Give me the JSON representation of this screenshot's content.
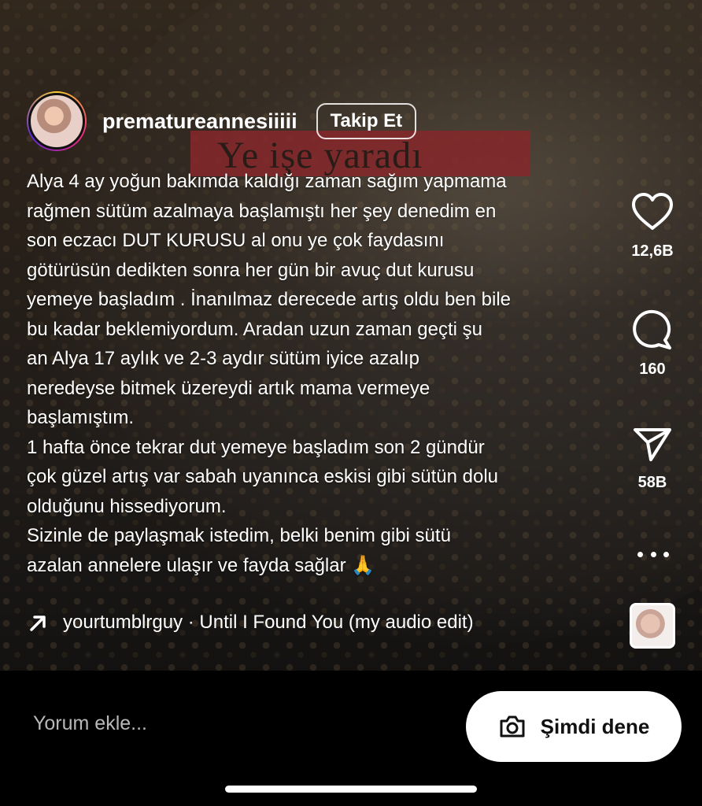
{
  "video": {
    "overlay_text": "Ye işe yaradı"
  },
  "header": {
    "username": "prematureannesiiiii",
    "follow_label": "Takip Et"
  },
  "caption": {
    "text": "Alya 4 ay yoğun bakımda kaldığı zaman sağım yapmama\nrağmen sütüm azalmaya başlamıştı her şey denedim en\nson eczacı DUT KURUSU al onu ye çok faydasını\ngötürüsün dedikten sonra her gün bir avuç dut kurusu\nyemeye başladım . İnanılmaz derecede artış oldu ben bile\nbu kadar beklemiyordum. Aradan uzun zaman geçti şu\nan Alya 17 aylık ve 2-3 aydır sütüm iyice azalıp\nneredeyse bitmek üzereydi artık mama vermeye\nbaşlamıştım.\n1 hafta önce tekrar dut yemeye başladım son 2 gündür\nçok güzel artış var sabah uyanınca eskisi gibi sütün dolu\nolduğunu hissediyorum.\nSizinle de paylaşmak istedim, belki benim gibi sütü\nazalan annelere ulaşır ve fayda sağlar",
    "emoji": "🙏"
  },
  "music": {
    "label": "yourtumblrguy · Until I Found You (my audio edit)"
  },
  "actions": {
    "like_count": "12,6B",
    "comment_count": "160",
    "share_count": "58B"
  },
  "bottom": {
    "comment_placeholder": "Yorum ekle...",
    "try_label": "Şimdi dene"
  },
  "colors": {
    "follow_border": "#ffffff",
    "overlay_banner": "#c63a3e",
    "background": "#000000"
  }
}
